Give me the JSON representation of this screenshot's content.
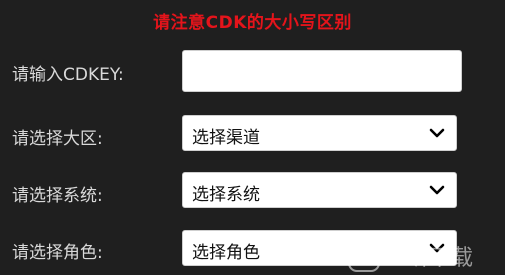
{
  "notice": "请注意CDK的大小写区别",
  "fields": {
    "cdkey": {
      "label": "请输入CDKEY:",
      "value": "",
      "placeholder": ""
    },
    "region": {
      "label": "请选择大区:",
      "selected": "选择渠道"
    },
    "system": {
      "label": "请选择系统:",
      "selected": "选择系统"
    },
    "role": {
      "label": "请选择角色:",
      "selected": "选择角色"
    }
  },
  "icons": {
    "chevron": "chevron-down-icon",
    "watermark": "yiting-xiazai-watermark-logo"
  },
  "colors": {
    "background": "#1f1f1f",
    "notice": "#e4141b",
    "label": "#d9d9d9",
    "control_bg": "#ffffff"
  },
  "watermark": {
    "text": "一听下载"
  }
}
